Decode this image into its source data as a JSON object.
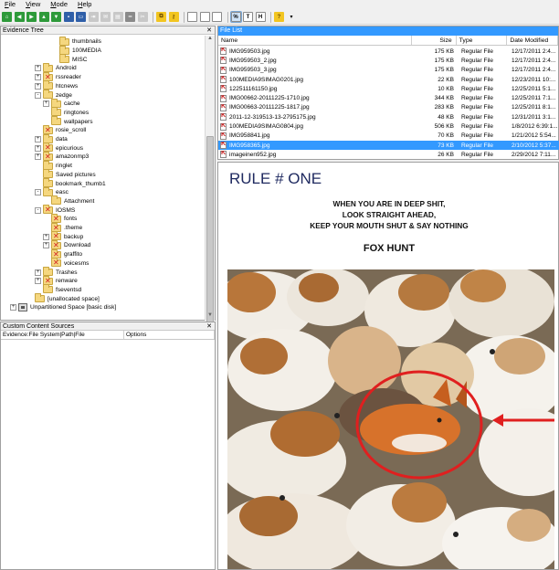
{
  "menu": [
    "File",
    "View",
    "Mode",
    "Help"
  ],
  "toolbar": {
    "icons": [
      "home-icon",
      "back-icon",
      "forward-icon",
      "up-icon",
      "filter-icon",
      "save-icon",
      "print-icon",
      "export-icon",
      "email-icon",
      "report-icon",
      "pipe-icon",
      "bookmark-icon",
      "search-icon",
      "key-icon",
      "doc-icon",
      "doc2-icon",
      "doc3-icon",
      "hex-view-icon",
      "text-view-icon",
      "hex-text-icon",
      "help-icon"
    ]
  },
  "evidence_tree": {
    "title": "Evidence Tree",
    "nodes": [
      {
        "label": "thumbnails",
        "level": 5,
        "expander": "none",
        "type": "folder"
      },
      {
        "label": "100MEDIA",
        "level": 5,
        "expander": "none",
        "type": "folder"
      },
      {
        "label": "MISC",
        "level": 5,
        "expander": "none",
        "type": "folder"
      },
      {
        "label": "Android",
        "level": 3,
        "expander": "+",
        "type": "folder"
      },
      {
        "label": "rssreader",
        "level": 3,
        "expander": "+",
        "type": "deleted"
      },
      {
        "label": "htcnews",
        "level": 3,
        "expander": "+",
        "type": "folder"
      },
      {
        "label": "zedge",
        "level": 3,
        "expander": "-",
        "type": "folder"
      },
      {
        "label": "cache",
        "level": 4,
        "expander": "+",
        "type": "folder"
      },
      {
        "label": "ringtones",
        "level": 4,
        "expander": "none",
        "type": "folder"
      },
      {
        "label": "wallpapers",
        "level": 4,
        "expander": "none",
        "type": "folder"
      },
      {
        "label": "rosie_scroll",
        "level": 3,
        "expander": "none",
        "type": "deleted"
      },
      {
        "label": "data",
        "level": 3,
        "expander": "+",
        "type": "folder"
      },
      {
        "label": "epicurious",
        "level": 3,
        "expander": "+",
        "type": "deleted"
      },
      {
        "label": "amazonmp3",
        "level": 3,
        "expander": "+",
        "type": "deleted"
      },
      {
        "label": "ringlet",
        "level": 3,
        "expander": "none",
        "type": "folder"
      },
      {
        "label": "Saved pictures",
        "level": 3,
        "expander": "none",
        "type": "folder"
      },
      {
        "label": "bookmark_thumb1",
        "level": 3,
        "expander": "none",
        "type": "folder"
      },
      {
        "label": "easc",
        "level": 3,
        "expander": "-",
        "type": "folder"
      },
      {
        "label": "Attachment",
        "level": 4,
        "expander": "none",
        "type": "folder"
      },
      {
        "label": "IOSMS",
        "level": 3,
        "expander": "-",
        "type": "deleted"
      },
      {
        "label": "fonts",
        "level": 4,
        "expander": "none",
        "type": "deleted"
      },
      {
        "label": ".theme",
        "level": 4,
        "expander": "none",
        "type": "deleted"
      },
      {
        "label": "backup",
        "level": 4,
        "expander": "+",
        "type": "deleted"
      },
      {
        "label": "Download",
        "level": 4,
        "expander": "+",
        "type": "deleted"
      },
      {
        "label": "graffito",
        "level": 4,
        "expander": "none",
        "type": "deleted"
      },
      {
        "label": "voicesms",
        "level": 4,
        "expander": "none",
        "type": "deleted"
      },
      {
        "label": "Trashes",
        "level": 3,
        "expander": "+",
        "type": "folder"
      },
      {
        "label": "renware",
        "level": 3,
        "expander": "+",
        "type": "deleted"
      },
      {
        "label": "fseventsd",
        "level": 3,
        "expander": "none",
        "type": "folder"
      },
      {
        "label": "[unallocated space]",
        "level": 2,
        "expander": "none",
        "type": "folder"
      },
      {
        "label": "Unpartitioned Space [basic disk]",
        "level": 0,
        "expander": "+",
        "type": "disk"
      }
    ]
  },
  "custom_sources": {
    "title": "Custom Content Sources",
    "columns": [
      "Evidence:File System|Path|File",
      "Options"
    ]
  },
  "file_list": {
    "title": "File List",
    "columns": [
      "Name",
      "Size",
      "Type",
      "Date Modified"
    ],
    "rows": [
      {
        "name": "IMG959503.jpg",
        "size": "175 KB",
        "type": "Regular File",
        "date": "12/17/2011 2:4..."
      },
      {
        "name": "IMG959503_2.jpg",
        "size": "175 KB",
        "type": "Regular File",
        "date": "12/17/2011 2:4..."
      },
      {
        "name": "IMG959503_3.jpg",
        "size": "175 KB",
        "type": "Regular File",
        "date": "12/17/2011 2:4..."
      },
      {
        "name": "100MEDIA9SIMAG0201.jpg",
        "size": "22 KB",
        "type": "Regular File",
        "date": "12/23/2011 10:..."
      },
      {
        "name": "122511161150.jpg",
        "size": "10 KB",
        "type": "Regular File",
        "date": "12/25/2011 5:1..."
      },
      {
        "name": "IMG00662-20111225-1710.jpg",
        "size": "344 KB",
        "type": "Regular File",
        "date": "12/25/2011 7:1..."
      },
      {
        "name": "IMG00663-20111225-1817.jpg",
        "size": "283 KB",
        "type": "Regular File",
        "date": "12/25/2011 8:1..."
      },
      {
        "name": "2011-12-319513-13-2795175.jpg",
        "size": "48 KB",
        "type": "Regular File",
        "date": "12/31/2011 3:1..."
      },
      {
        "name": "100MEDIA9SIMAG0804.jpg",
        "size": "506 KB",
        "type": "Regular File",
        "date": "1/8/2012 6:39:1..."
      },
      {
        "name": "IMG958841.jpg",
        "size": "70 KB",
        "type": "Regular File",
        "date": "1/21/2012 5:54..."
      },
      {
        "name": "IMG958365.jpg",
        "size": "73 KB",
        "type": "Regular File",
        "date": "2/10/2012 5:37...",
        "selected": true
      },
      {
        "name": "imageinen952.jpg",
        "size": "26 KB",
        "type": "Regular File",
        "date": "2/29/2012 7:11..."
      }
    ]
  },
  "preview": {
    "title": "RULE # ONE",
    "lines": [
      "WHEN YOU ARE IN DEEP SHIT,",
      "LOOK STRAIGHT AHEAD,",
      "KEEP YOUR MOUTH SHUT & SAY NOTHING"
    ],
    "subtitle": "FOX HUNT"
  }
}
